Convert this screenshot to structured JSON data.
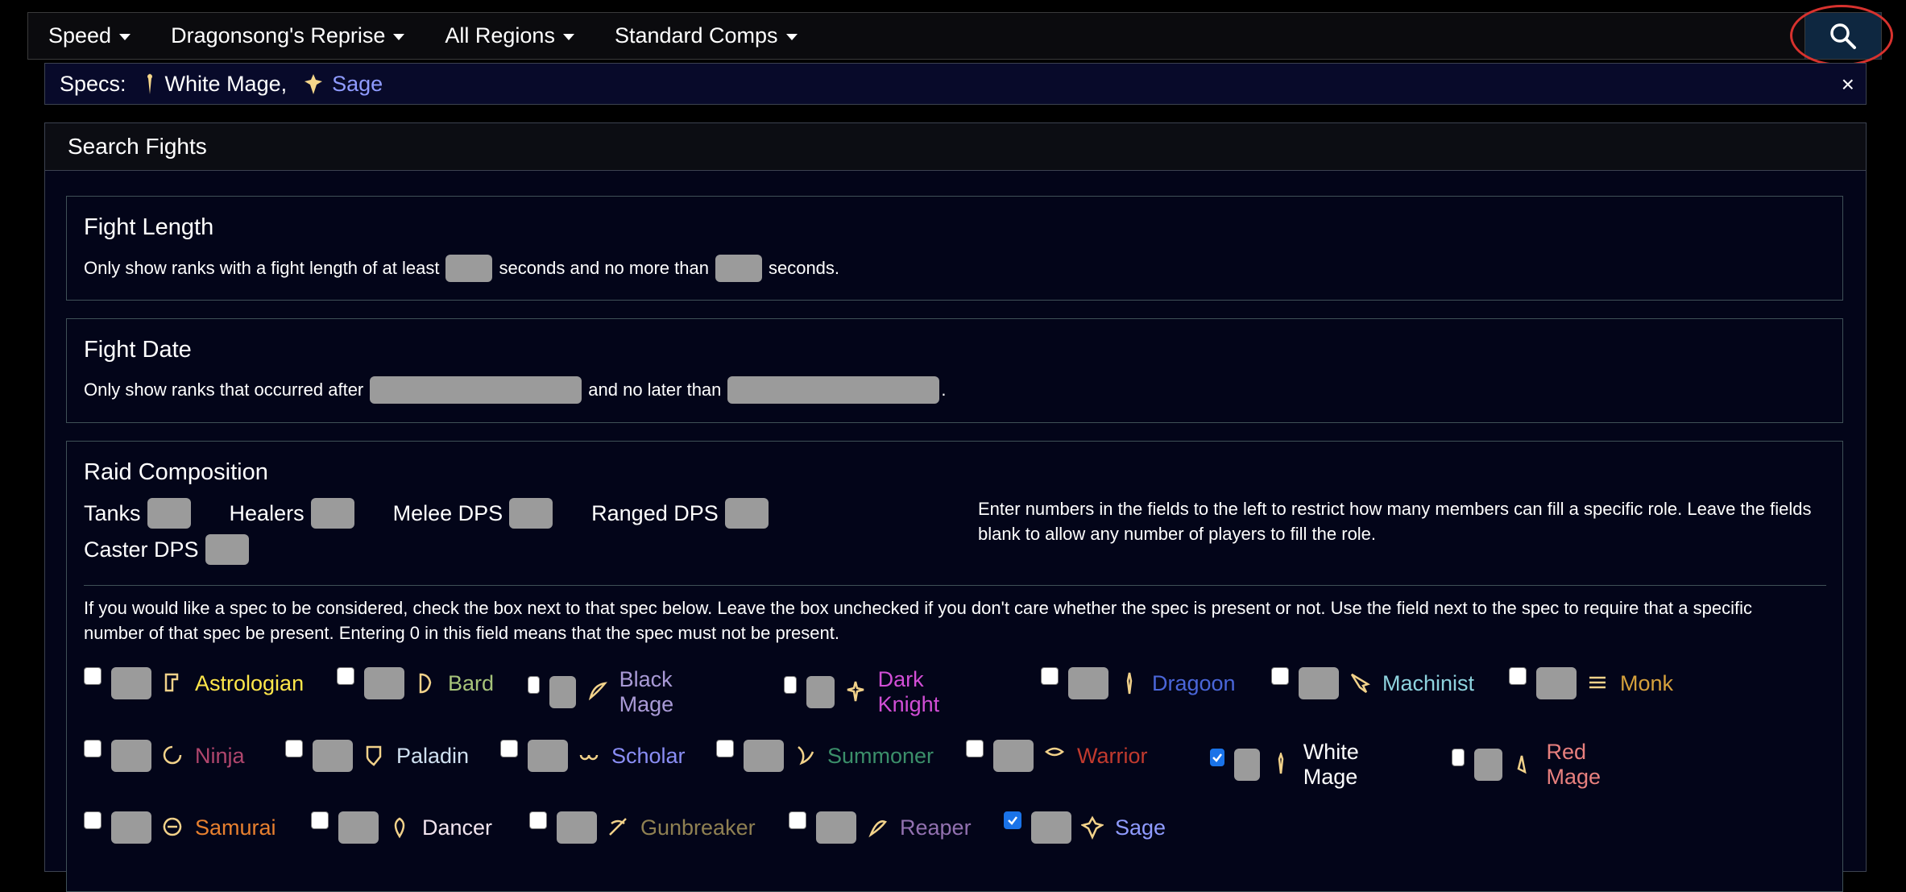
{
  "topbar": {
    "menus": [
      "Speed",
      "Dragonsong's Reprise",
      "All Regions",
      "Standard Comps"
    ]
  },
  "specs_bar": {
    "label": "Specs:",
    "items": [
      {
        "name": "White Mage,",
        "color": "#ffffff"
      },
      {
        "name": "Sage",
        "color": "#8f9bff"
      }
    ],
    "close": "×"
  },
  "panel": {
    "title": "Search Fights",
    "fight_length": {
      "title": "Fight Length",
      "text_a": "Only show ranks with a fight length of at least",
      "text_b": "seconds and no more than",
      "text_c": "seconds."
    },
    "fight_date": {
      "title": "Fight Date",
      "text_a": "Only show ranks that occurred after",
      "text_b": "and no later than",
      "text_c": "."
    },
    "raid": {
      "title": "Raid Composition",
      "roles": [
        "Tanks",
        "Healers",
        "Melee DPS",
        "Ranged DPS",
        "Caster DPS"
      ],
      "help": "Enter numbers in the fields to the left to restrict how many members can fill a specific role. Leave the fields blank to allow any number of players to fill the role.",
      "spec_note": "If you would like a spec to be considered, check the box next to that spec below. Leave the box unchecked if you don't care whether the spec is present or not. Use the field next to the spec to require that a specific number of that spec be present. Entering 0 in this field means that the spec must not be present.",
      "specs": [
        {
          "name": "Astrologian",
          "color": "#ffe74a",
          "checked": false
        },
        {
          "name": "Bard",
          "color": "#a6c37a",
          "checked": false
        },
        {
          "name": "Black Mage",
          "color": "#a99ad6",
          "checked": false
        },
        {
          "name": "Dark Knight",
          "color": "#d24ed6",
          "checked": false
        },
        {
          "name": "Dragoon",
          "color": "#4a66d9",
          "checked": false
        },
        {
          "name": "Machinist",
          "color": "#8ed3de",
          "checked": false
        },
        {
          "name": "Monk",
          "color": "#d6a13c",
          "checked": false
        },
        {
          "name": "Ninja",
          "color": "#b0466d",
          "checked": false
        },
        {
          "name": "Paladin",
          "color": "#cfe0f0",
          "checked": false
        },
        {
          "name": "Scholar",
          "color": "#8a8ef5",
          "checked": false
        },
        {
          "name": "Summoner",
          "color": "#3b8f6a",
          "checked": false
        },
        {
          "name": "Warrior",
          "color": "#c23a2e",
          "checked": false
        },
        {
          "name": "White Mage",
          "color": "#ffffff",
          "checked": true
        },
        {
          "name": "Red Mage",
          "color": "#e8807e",
          "checked": false
        },
        {
          "name": "Samurai",
          "color": "#e8802f",
          "checked": false
        },
        {
          "name": "Dancer",
          "color": "#f1e4ee",
          "checked": false
        },
        {
          "name": "Gunbreaker",
          "color": "#8f8052",
          "checked": false
        },
        {
          "name": "Reaper",
          "color": "#9271b0",
          "checked": false
        },
        {
          "name": "Sage",
          "color": "#8f9bff",
          "checked": true
        }
      ]
    }
  }
}
